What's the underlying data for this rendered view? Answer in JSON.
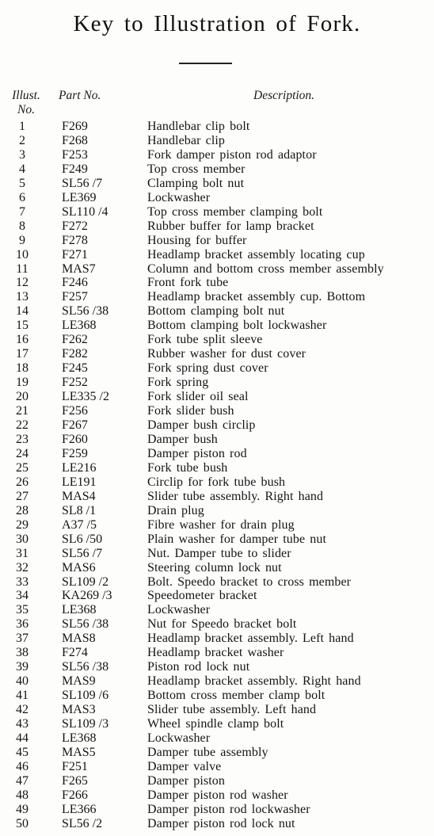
{
  "title": "Key to Illustration of Fork.",
  "headers": {
    "illust_no": "Illust.\nNo.",
    "illust_line1": "Illust.",
    "illust_line2": "No.",
    "part_no": "Part No.",
    "description": "Description."
  },
  "rows": [
    {
      "no": "1",
      "part": "F269",
      "desc": "Handlebar clip bolt"
    },
    {
      "no": "2",
      "part": "F268",
      "desc": "Handlebar clip"
    },
    {
      "no": "3",
      "part": "F253",
      "desc": "Fork damper piston rod adaptor"
    },
    {
      "no": "4",
      "part": "F249",
      "desc": "Top cross member"
    },
    {
      "no": "5",
      "part": "SL56 /7",
      "desc": "Clamping bolt nut"
    },
    {
      "no": "6",
      "part": "LE369",
      "desc": "Lockwasher"
    },
    {
      "no": "7",
      "part": "SL110 /4",
      "desc": "Top cross member clamping bolt"
    },
    {
      "no": "8",
      "part": "F272",
      "desc": "Rubber buffer for lamp bracket"
    },
    {
      "no": "9",
      "part": "F278",
      "desc": "Housing for buffer"
    },
    {
      "no": "10",
      "part": "F271",
      "desc": "Headlamp bracket assembly locating cup"
    },
    {
      "no": "11",
      "part": "MAS7",
      "desc": "Column and bottom cross member assembly"
    },
    {
      "no": "12",
      "part": "F246",
      "desc": "Front fork tube"
    },
    {
      "no": "13",
      "part": "F257",
      "desc": "Headlamp bracket assembly cup.   Bottom"
    },
    {
      "no": "14",
      "part": "SL56 /38",
      "desc": "Bottom clamping bolt nut"
    },
    {
      "no": "15",
      "part": "LE368",
      "desc": "Bottom clamping bolt lockwasher"
    },
    {
      "no": "16",
      "part": "F262",
      "desc": "Fork tube split sleeve"
    },
    {
      "no": "17",
      "part": "F282",
      "desc": "Rubber washer for dust cover"
    },
    {
      "no": "18",
      "part": "F245",
      "desc": "Fork spring dust cover"
    },
    {
      "no": "19",
      "part": "F252",
      "desc": "Fork spring"
    },
    {
      "no": "20",
      "part": "LE335 /2",
      "desc": "Fork slider oil seal"
    },
    {
      "no": "21",
      "part": "F256",
      "desc": "Fork slider bush"
    },
    {
      "no": "22",
      "part": "F267",
      "desc": "Damper bush circlip"
    },
    {
      "no": "23",
      "part": "F260",
      "desc": "Damper bush"
    },
    {
      "no": "24",
      "part": "F259",
      "desc": "Damper piston rod"
    },
    {
      "no": "25",
      "part": "LE216",
      "desc": "Fork tube bush"
    },
    {
      "no": "26",
      "part": "LE191",
      "desc": "Circlip for fork tube bush"
    },
    {
      "no": "27",
      "part": "MAS4",
      "desc": "Slider tube assembly.  Right hand"
    },
    {
      "no": "28",
      "part": "SL8 /1",
      "desc": "Drain plug"
    },
    {
      "no": "29",
      "part": "A37 /5",
      "desc": "Fibre washer for drain plug"
    },
    {
      "no": "30",
      "part": "SL6 /50",
      "desc": "Plain washer for damper tube nut"
    },
    {
      "no": "31",
      "part": "SL56 /7",
      "desc": "Nut.  Damper tube to slider"
    },
    {
      "no": "32",
      "part": "MAS6",
      "desc": "Steering column lock nut"
    },
    {
      "no": "33",
      "part": "SL109 /2",
      "desc": "Bolt.  Speedo bracket to cross member"
    },
    {
      "no": "34",
      "part": "KA269 /3",
      "desc": "Speedometer bracket"
    },
    {
      "no": "35",
      "part": "LE368",
      "desc": "Lockwasher"
    },
    {
      "no": "36",
      "part": "SL56 /38",
      "desc": "Nut for Speedo bracket bolt"
    },
    {
      "no": "37",
      "part": "MAS8",
      "desc": "Headlamp bracket assembly.  Left hand"
    },
    {
      "no": "38",
      "part": "F274",
      "desc": "Headlamp bracket washer"
    },
    {
      "no": "39",
      "part": "SL56 /38",
      "desc": "Piston rod lock nut"
    },
    {
      "no": "40",
      "part": "MAS9",
      "desc": "Headlamp bracket assembly.  Right hand"
    },
    {
      "no": "41",
      "part": "SL109 /6",
      "desc": "Bottom cross member clamp bolt"
    },
    {
      "no": "42",
      "part": "MAS3",
      "desc": "Slider tube assembly.  Left hand"
    },
    {
      "no": "43",
      "part": "SL109 /3",
      "desc": "Wheel spindle clamp bolt"
    },
    {
      "no": "44",
      "part": "LE368",
      "desc": "Lockwasher"
    },
    {
      "no": "45",
      "part": "MAS5",
      "desc": "Damper tube assembly"
    },
    {
      "no": "46",
      "part": "F251",
      "desc": "Damper valve"
    },
    {
      "no": "47",
      "part": "F265",
      "desc": "Damper piston"
    },
    {
      "no": "48",
      "part": "F266",
      "desc": "Damper piston rod washer"
    },
    {
      "no": "49",
      "part": "LE366",
      "desc": "Damper piston rod lockwasher"
    },
    {
      "no": "50",
      "part": "SL56 /2",
      "desc": "Damper piston rod lock nut"
    }
  ]
}
